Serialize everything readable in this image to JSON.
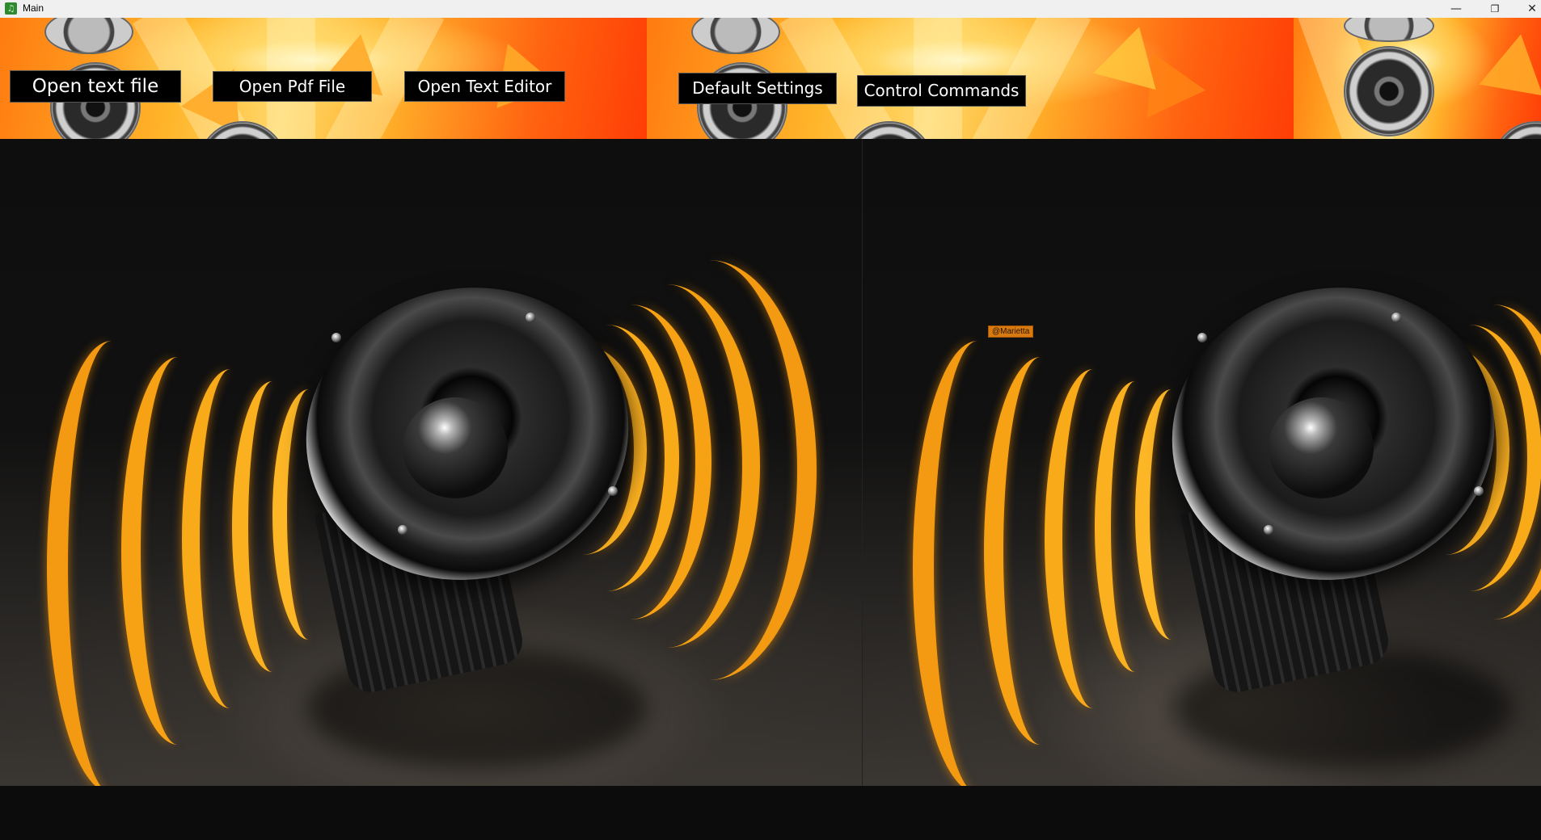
{
  "window": {
    "title": "Main",
    "controls": {
      "minimize": "—",
      "restore": "❐",
      "close": "✕"
    }
  },
  "toolbar": {
    "open_text_file": "Open text file",
    "open_pdf_file": "Open Pdf File",
    "open_text_editor": "Open Text Editor",
    "default_settings": "Default Settings",
    "control_commands": "Control Commands"
  },
  "tag": {
    "label": "@Marietta"
  },
  "colors": {
    "banner_orange": "#ff6a10",
    "banner_yellow": "#ffd86a",
    "wave_orange": "#ff9a10",
    "background": "#0c0c0c",
    "button_bg": "#000000",
    "button_text": "#ffffff"
  },
  "icons": [
    "app-icon",
    "minimize-icon",
    "restore-icon",
    "close-icon"
  ]
}
